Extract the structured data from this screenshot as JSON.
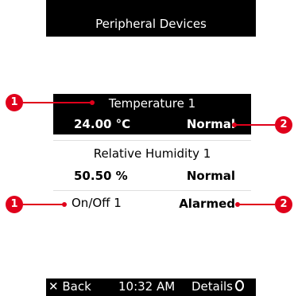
{
  "screen": {
    "title": "Peripheral Devices",
    "devices": [
      {
        "name": "Temperature 1",
        "value": "24.00 °C",
        "status": "Normal"
      },
      {
        "name": "Relative Humidity 1",
        "value": "50.50 %",
        "status": "Normal"
      },
      {
        "name": "On/Off 1",
        "value": "",
        "status": "Alarmed"
      }
    ],
    "bottom": {
      "back": "Back",
      "time": "10:32 AM",
      "details": "Details"
    }
  },
  "annotations": {
    "left": "1",
    "right": "2",
    "color": "#e0001b"
  }
}
